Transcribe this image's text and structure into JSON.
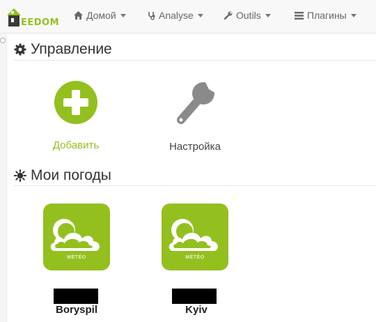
{
  "app": {
    "brand": "EEDOM"
  },
  "nav": {
    "items": [
      {
        "label": "Домой",
        "icon": "home-icon"
      },
      {
        "label": "Analyse",
        "icon": "stethoscope-icon"
      },
      {
        "label": "Outils",
        "icon": "wrench-icon"
      },
      {
        "label": "Плагины",
        "icon": "list-icon"
      }
    ]
  },
  "management": {
    "title": "Управление",
    "add_label": "Добавить",
    "config_label": "Настройка"
  },
  "weather": {
    "title": "Мои погоды",
    "tile_caption": "MÉTÉO",
    "items": [
      {
        "city": "Boryspil"
      },
      {
        "city": "Kyiv"
      }
    ]
  },
  "colors": {
    "accent": "#93c01f",
    "text": "#333333"
  }
}
